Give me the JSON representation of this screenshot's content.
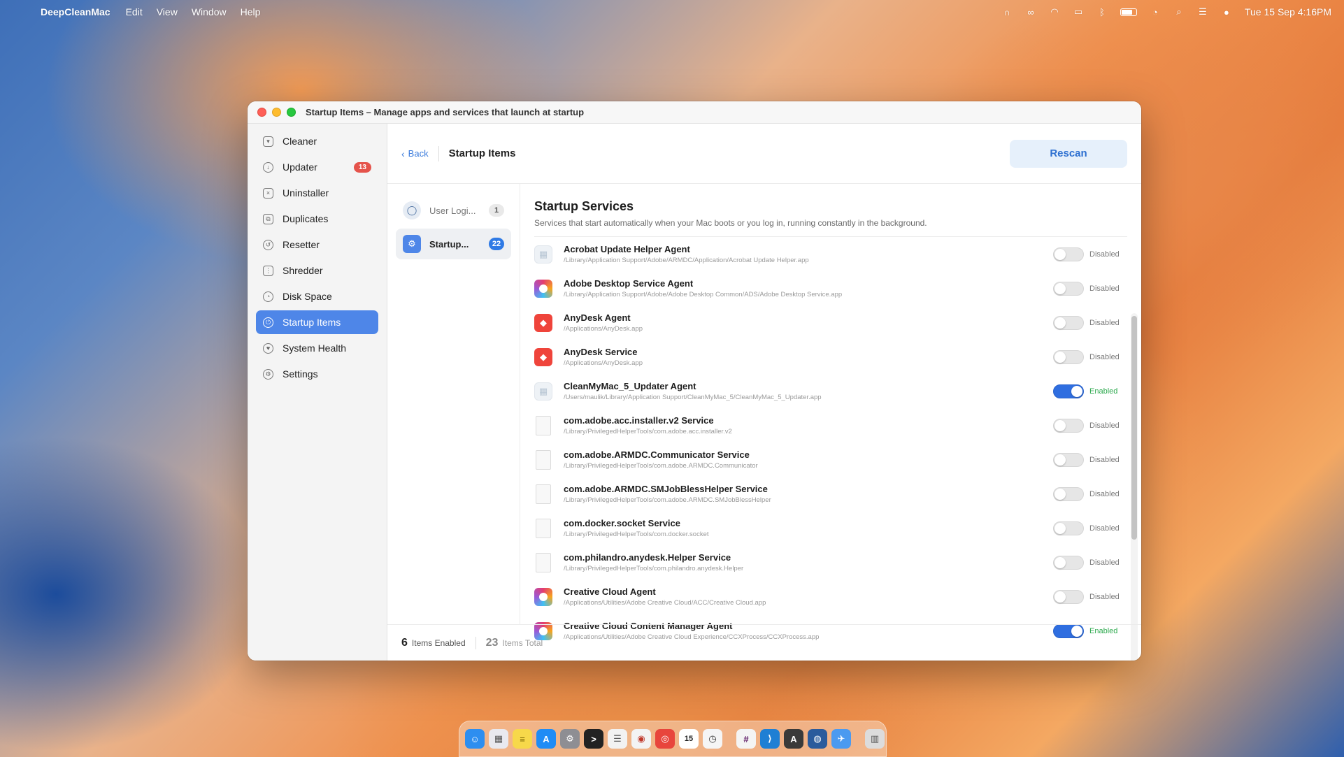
{
  "menubar": {
    "app_name": "DeepCleanMac",
    "menus": [
      "Edit",
      "View",
      "Window",
      "Help"
    ],
    "datetime": "Tue 15 Sep  4:16PM",
    "status_icons": [
      "headphones-icon",
      "creative-cloud-icon",
      "airdrop-icon",
      "screen-icon",
      "bluetooth-icon",
      "battery-icon",
      "wifi-icon",
      "spotlight-icon",
      "control-center-icon",
      "siri-icon"
    ]
  },
  "window": {
    "title": "Startup Items – Manage apps and services that launch at startup"
  },
  "sidebar": {
    "items": [
      {
        "label": "Cleaner",
        "icon": "trash-icon"
      },
      {
        "label": "Updater",
        "icon": "download-icon",
        "badge": "13"
      },
      {
        "label": "Uninstaller",
        "icon": "uninstall-icon"
      },
      {
        "label": "Duplicates",
        "icon": "duplicate-icon"
      },
      {
        "label": "Resetter",
        "icon": "reset-icon"
      },
      {
        "label": "Shredder",
        "icon": "shredder-icon"
      },
      {
        "label": "Disk Space",
        "icon": "pie-icon"
      },
      {
        "label": "Startup Items",
        "icon": "startup-icon",
        "active": true
      },
      {
        "label": "System Health",
        "icon": "health-icon"
      },
      {
        "label": "Settings",
        "icon": "gear-icon"
      }
    ]
  },
  "header": {
    "back_label": "Back",
    "title": "Startup Items",
    "rescan_label": "Rescan"
  },
  "categories": [
    {
      "label": "User Logi...",
      "count": "1",
      "icon": "user-icon"
    },
    {
      "label": "Startup...",
      "count": "22",
      "icon": "gears-icon",
      "active": true
    }
  ],
  "section": {
    "title": "Startup Services",
    "description": "Services that start automatically when your Mac boots or you log in, running constantly in the background."
  },
  "items": [
    {
      "name": "Acrobat Update Helper Agent",
      "path": "/Library/Application Support/Adobe/ARMDC/Application/Acrobat Update Helper.app",
      "status": "Disabled",
      "enabled": false,
      "icon": "plain"
    },
    {
      "name": "Adobe Desktop Service Agent",
      "path": "/Library/Application Support/Adobe/Adobe Desktop Common/ADS/Adobe Desktop Service.app",
      "status": "Disabled",
      "enabled": false,
      "icon": "cc"
    },
    {
      "name": "AnyDesk Agent",
      "path": "/Applications/AnyDesk.app",
      "status": "Disabled",
      "enabled": false,
      "icon": "anydesk"
    },
    {
      "name": "AnyDesk Service",
      "path": "/Applications/AnyDesk.app",
      "status": "Disabled",
      "enabled": false,
      "icon": "anydesk"
    },
    {
      "name": "CleanMyMac_5_Updater Agent",
      "path": "/Users/maulik/Library/Application Support/CleanMyMac_5/CleanMyMac_5_Updater.app",
      "status": "Enabled",
      "enabled": true,
      "icon": "plain"
    },
    {
      "name": "com.adobe.acc.installer.v2 Service",
      "path": "/Library/PrivilegedHelperTools/com.adobe.acc.installer.v2",
      "status": "Disabled",
      "enabled": false,
      "icon": "doc"
    },
    {
      "name": "com.adobe.ARMDC.Communicator Service",
      "path": "/Library/PrivilegedHelperTools/com.adobe.ARMDC.Communicator",
      "status": "Disabled",
      "enabled": false,
      "icon": "doc"
    },
    {
      "name": "com.adobe.ARMDC.SMJobBlessHelper Service",
      "path": "/Library/PrivilegedHelperTools/com.adobe.ARMDC.SMJobBlessHelper",
      "status": "Disabled",
      "enabled": false,
      "icon": "doc"
    },
    {
      "name": "com.docker.socket Service",
      "path": "/Library/PrivilegedHelperTools/com.docker.socket",
      "status": "Disabled",
      "enabled": false,
      "icon": "doc"
    },
    {
      "name": "com.philandro.anydesk.Helper Service",
      "path": "/Library/PrivilegedHelperTools/com.philandro.anydesk.Helper",
      "status": "Disabled",
      "enabled": false,
      "icon": "doc"
    },
    {
      "name": "Creative Cloud Agent",
      "path": "/Applications/Utilities/Adobe Creative Cloud/ACC/Creative Cloud.app",
      "status": "Disabled",
      "enabled": false,
      "icon": "cc"
    },
    {
      "name": "Creative Cloud Content Manager Agent",
      "path": "/Applications/Utilities/Adobe Creative Cloud Experience/CCXProcess/CCXProcess.app",
      "status": "Enabled",
      "enabled": true,
      "icon": "cc"
    }
  ],
  "footer": {
    "enabled_count": "6",
    "enabled_label": "Items Enabled",
    "total_count": "23",
    "total_label": "Items Total"
  },
  "dock": {
    "apps": [
      {
        "name": "finder",
        "color": "#2d8ef0",
        "glyph": "☺"
      },
      {
        "name": "launchpad",
        "color": "#e9e9ef",
        "glyph": "▦"
      },
      {
        "name": "notes",
        "color": "#f7d84a",
        "glyph": "≡"
      },
      {
        "name": "app-store",
        "color": "#1f8cf5",
        "glyph": "A"
      },
      {
        "name": "system-settings",
        "color": "#8e8e93",
        "glyph": "⚙"
      },
      {
        "name": "terminal",
        "color": "#222222",
        "glyph": ">"
      },
      {
        "name": "reminders",
        "color": "#f2f2f2",
        "glyph": "☰"
      },
      {
        "name": "anydesk-like",
        "color": "#f3f3f3",
        "glyph": "◉"
      },
      {
        "name": "chrome",
        "color": "#e8453c",
        "glyph": "◎"
      },
      {
        "name": "calendar",
        "color": "#ffffff",
        "glyph": "15"
      },
      {
        "name": "clock",
        "color": "#f5f5f5",
        "glyph": "◷"
      },
      {
        "name": "slack",
        "color": "#f4f4f4",
        "glyph": "#"
      },
      {
        "name": "vscode",
        "color": "#1f7fd4",
        "glyph": "⟩"
      },
      {
        "name": "github-like",
        "color": "#3a3a3a",
        "glyph": "A"
      },
      {
        "name": "deepcleanmac",
        "color": "#2a5b9c",
        "glyph": "◍"
      },
      {
        "name": "safari-like",
        "color": "#4b9af0",
        "glyph": "✈"
      },
      {
        "name": "trash",
        "color": "#dcdcdc",
        "glyph": "🗑"
      }
    ]
  }
}
